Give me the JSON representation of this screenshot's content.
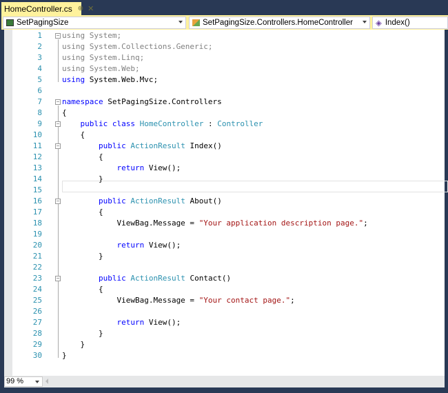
{
  "tab": {
    "title": "HomeController.cs",
    "pin": "⊕",
    "close": "✕"
  },
  "nav": {
    "project": "SetPagingSize",
    "type": "SetPagingSize.Controllers.HomeController",
    "member": "Index()"
  },
  "zoom": "99 %",
  "lines": [
    [
      [
        "g",
        "using System;"
      ]
    ],
    [
      [
        "g",
        "using System.Collections.Generic;"
      ]
    ],
    [
      [
        "g",
        "using System.Linq;"
      ]
    ],
    [
      [
        "g",
        "using System.Web;"
      ]
    ],
    [
      [
        "k",
        "using"
      ],
      [
        "p",
        " System.Web.Mvc;"
      ]
    ],
    [],
    [
      [
        "k",
        "namespace"
      ],
      [
        "p",
        " SetPagingSize.Controllers"
      ]
    ],
    [
      [
        "p",
        "{"
      ]
    ],
    [
      [
        "p",
        "    "
      ],
      [
        "k",
        "public class"
      ],
      [
        "p",
        " "
      ],
      [
        "t",
        "HomeController"
      ],
      [
        "p",
        " : "
      ],
      [
        "t",
        "Controller"
      ]
    ],
    [
      [
        "p",
        "    {"
      ]
    ],
    [
      [
        "p",
        "        "
      ],
      [
        "k",
        "public"
      ],
      [
        "p",
        " "
      ],
      [
        "t",
        "ActionResult"
      ],
      [
        "p",
        " Index()"
      ]
    ],
    [
      [
        "p",
        "        {"
      ]
    ],
    [
      [
        "p",
        "            "
      ],
      [
        "k",
        "return"
      ],
      [
        "p",
        " View();"
      ]
    ],
    [
      [
        "p",
        "        }"
      ]
    ],
    [],
    [
      [
        "p",
        "        "
      ],
      [
        "k",
        "public"
      ],
      [
        "p",
        " "
      ],
      [
        "t",
        "ActionResult"
      ],
      [
        "p",
        " About()"
      ]
    ],
    [
      [
        "p",
        "        {"
      ]
    ],
    [
      [
        "p",
        "            ViewBag.Message = "
      ],
      [
        "s",
        "\"Your application description page.\""
      ],
      [
        "p",
        ";"
      ]
    ],
    [],
    [
      [
        "p",
        "            "
      ],
      [
        "k",
        "return"
      ],
      [
        "p",
        " View();"
      ]
    ],
    [
      [
        "p",
        "        }"
      ]
    ],
    [],
    [
      [
        "p",
        "        "
      ],
      [
        "k",
        "public"
      ],
      [
        "p",
        " "
      ],
      [
        "t",
        "ActionResult"
      ],
      [
        "p",
        " Contact()"
      ]
    ],
    [
      [
        "p",
        "        {"
      ]
    ],
    [
      [
        "p",
        "            ViewBag.Message = "
      ],
      [
        "s",
        "\"Your contact page.\""
      ],
      [
        "p",
        ";"
      ]
    ],
    [],
    [
      [
        "p",
        "            "
      ],
      [
        "k",
        "return"
      ],
      [
        "p",
        " View();"
      ]
    ],
    [
      [
        "p",
        "        }"
      ]
    ],
    [
      [
        "p",
        "    }"
      ]
    ],
    [
      [
        "p",
        "}"
      ]
    ]
  ]
}
